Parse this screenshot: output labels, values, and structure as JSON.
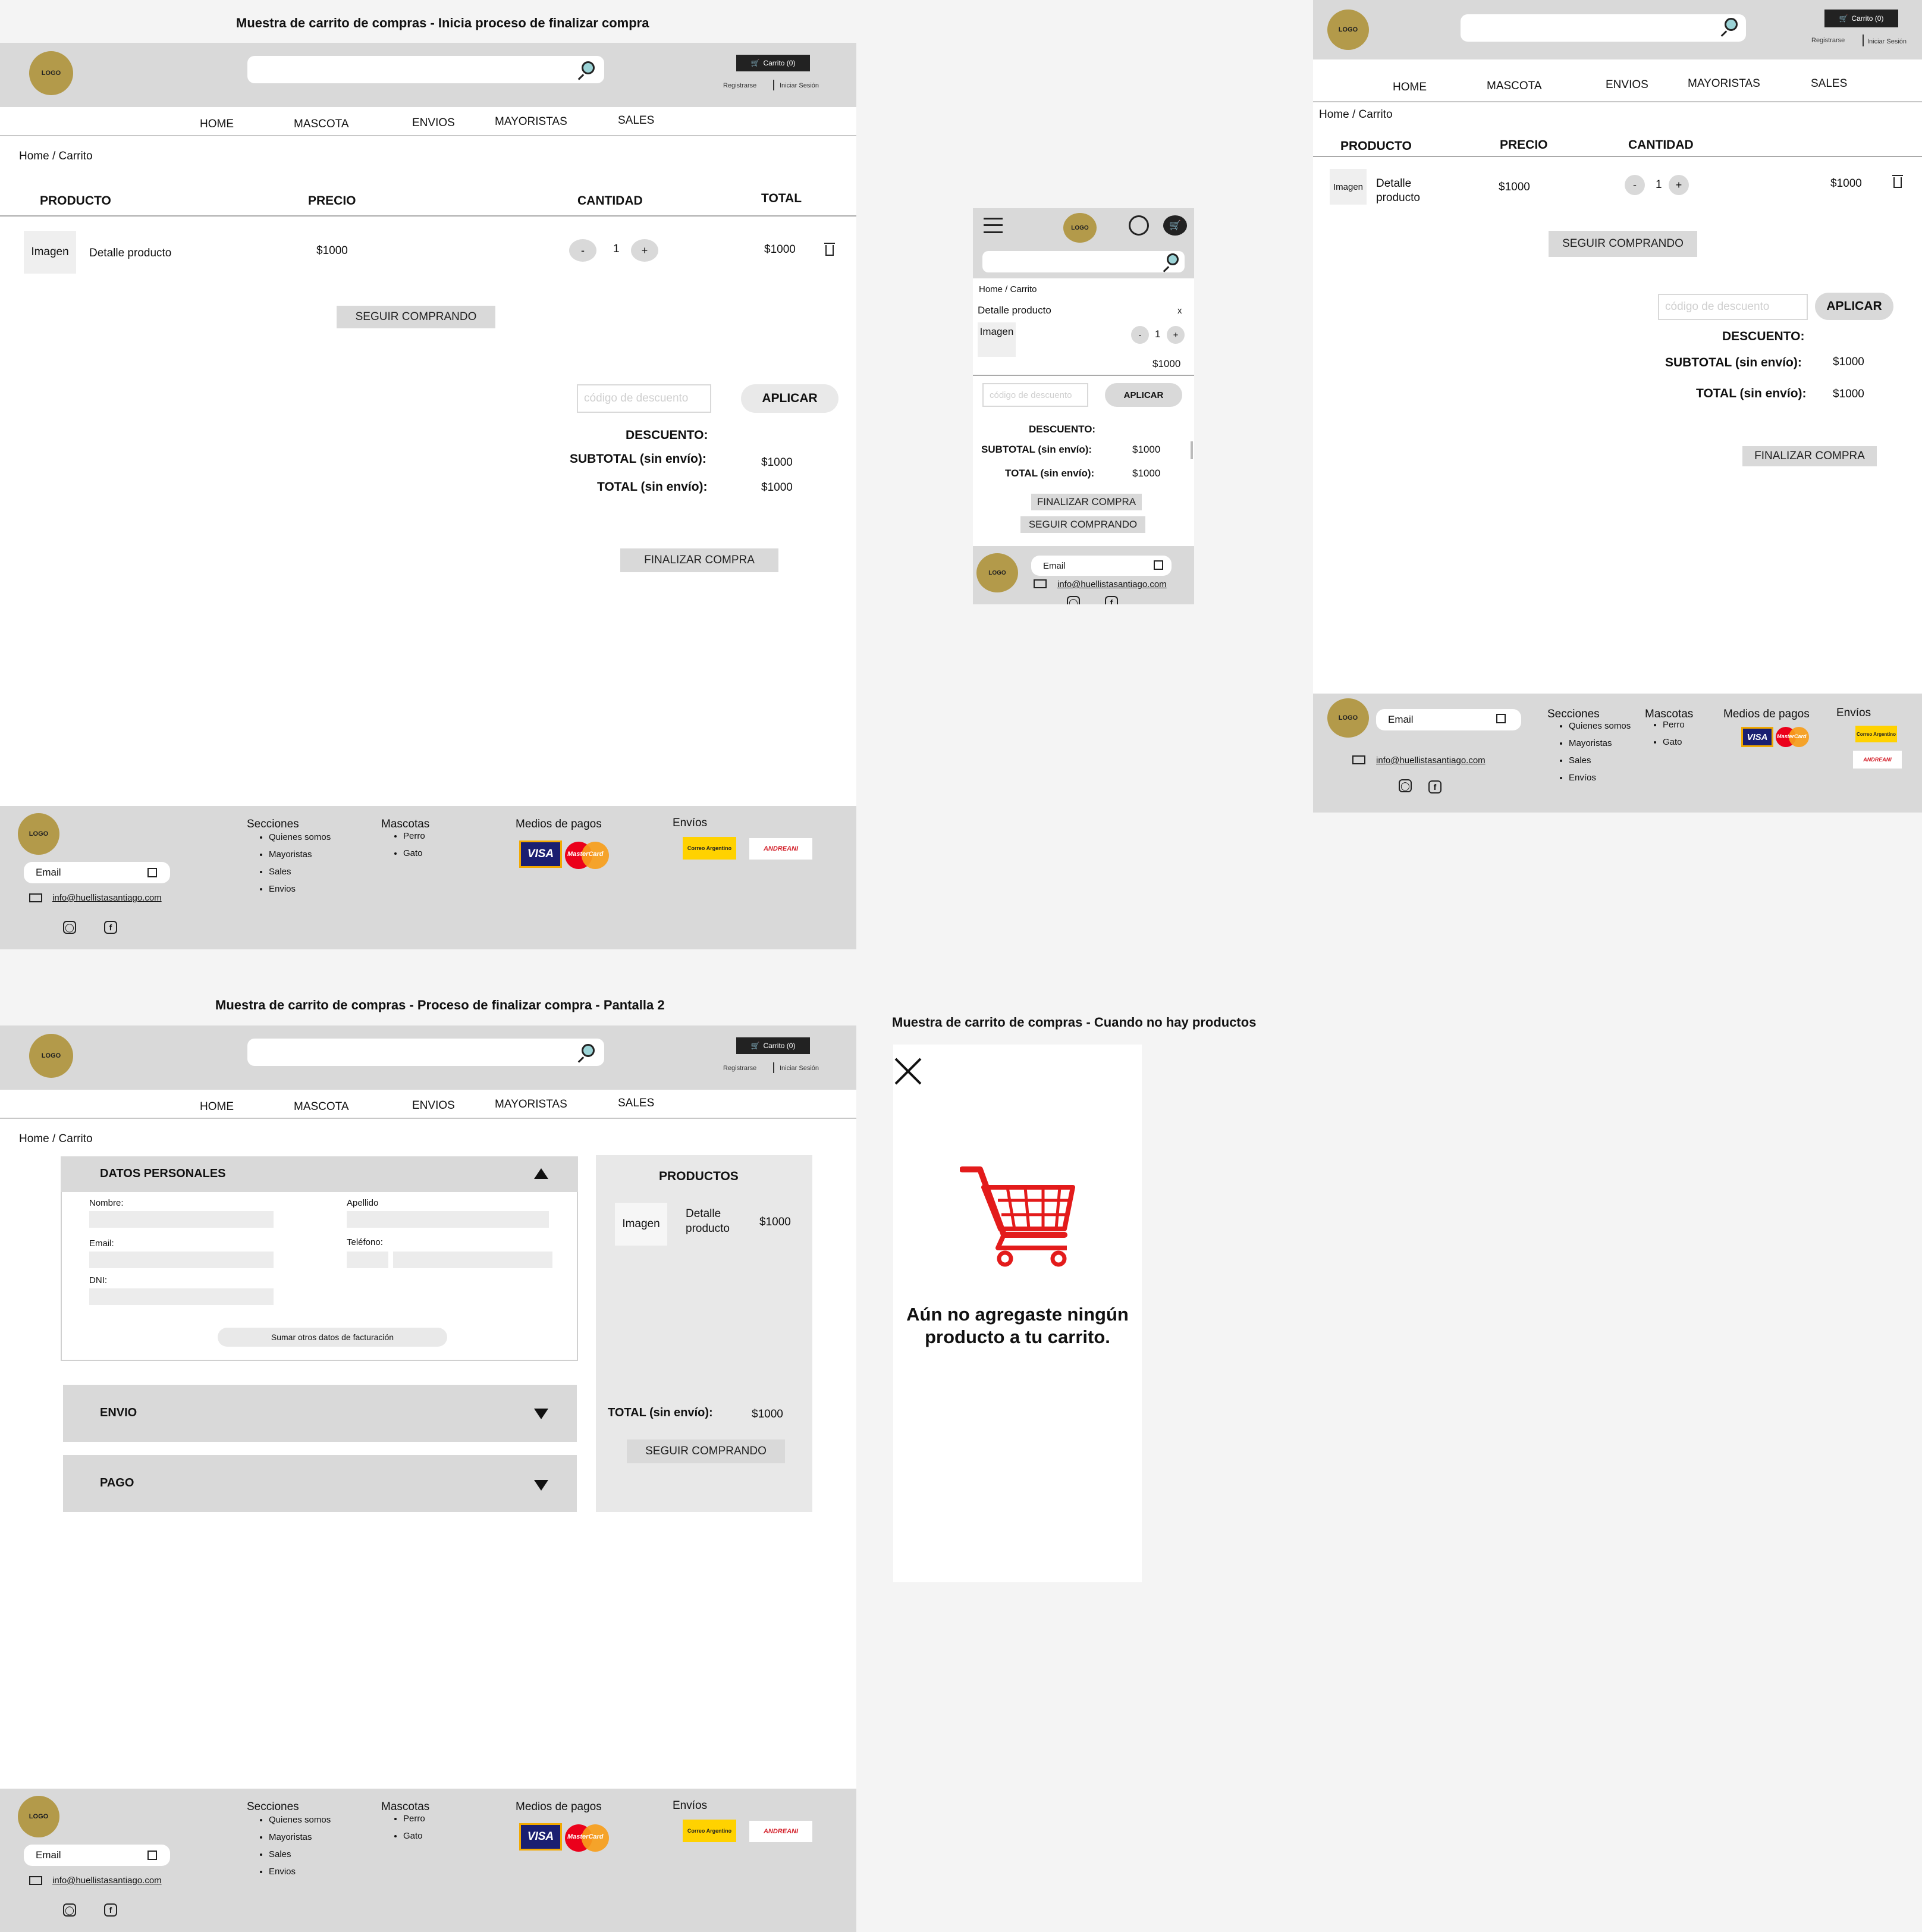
{
  "titles": {
    "screen1": "Muestra de carrito de compras - Inicia proceso de finalizar compra",
    "screen2": "Muestra de carrito de compras - Proceso de finalizar compra - Pantalla 2",
    "empty": "Muestra de carrito de compras - Cuando no hay productos"
  },
  "header": {
    "logo": "LOGO",
    "cart": "Carrito (0)",
    "register": "Registrarse",
    "login": "Iniciar Sesión"
  },
  "nav": [
    "HOME",
    "MASCOTA",
    "ENVIOS",
    "MAYORISTAS",
    "SALES"
  ],
  "breadcrumb": "Home / Carrito",
  "cart": {
    "col_product": "PRODUCTO",
    "col_price": "PRECIO",
    "col_qty": "CANTIDAD",
    "col_total": "TOTAL",
    "image": "Imagen",
    "detail": "Detalle producto",
    "detail_l1": "Detalle",
    "detail_l2": "producto",
    "price": "$1000",
    "qty": "1",
    "minus": "-",
    "plus": "+",
    "total": "$1000",
    "remove": "x",
    "continue": "SEGUIR COMPRANDO",
    "coupon_placeholder": "código de descuento",
    "apply": "APLICAR",
    "discount": "DESCUENTO:",
    "subtotal": "SUBTOTAL (sin envío):",
    "subtotal_value": "$1000",
    "total_label": "TOTAL (sin envío):",
    "total_value": "$1000",
    "checkout": "FINALIZAR COMPRA"
  },
  "checkout": {
    "personal": "DATOS PERSONALES",
    "nombre": "Nombre:",
    "apellido": "Apellido",
    "email": "Email:",
    "telefono": "Teléfono:",
    "dni": "DNI:",
    "billing": "Sumar otros datos de facturación",
    "envio": "ENVIO",
    "pago": "PAGO",
    "productos": "PRODUCTOS",
    "total_label": "TOTAL (sin envío):",
    "total_value": "$1000",
    "continue": "SEGUIR COMPRANDO"
  },
  "empty": {
    "message_l1": "Aún no agregaste ningún",
    "message_l2": "producto a tu carrito."
  },
  "footer": {
    "email_label": "Email",
    "email_address": "info@huellistasantiago.com",
    "sections_title": "Secciones",
    "sections": [
      "Quienes somos",
      "Mayoristas",
      "Sales",
      "Envios"
    ],
    "sections_alt": [
      "Quienes somos",
      "Mayoristas",
      "Sales",
      "Envíos"
    ],
    "pets_title": "Mascotas",
    "pets": [
      "Perro",
      "Gato"
    ],
    "payments_title": "Medios de pagos",
    "shipping_title": "Envíos",
    "visa": "VISA",
    "mastercard": "MasterCard",
    "correo": "Correo Argentino",
    "andreani": "ANDREANI"
  },
  "colors": {
    "logo": "#b39a4a",
    "gray": "#d9d9d9",
    "empty_cart": "#e31b1b"
  }
}
